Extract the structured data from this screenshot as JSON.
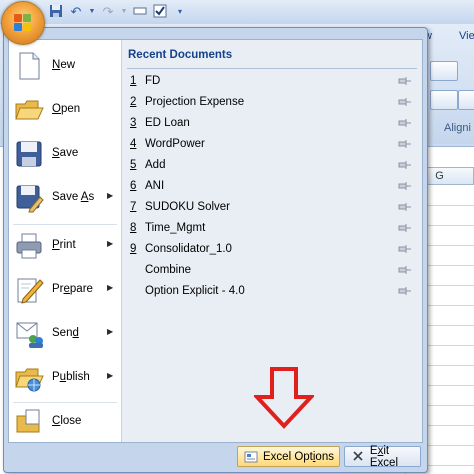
{
  "ribbon": {
    "tabs": [
      "View",
      "View"
    ],
    "group_label": "Aligni",
    "column_header": "G"
  },
  "quick_access": {
    "icons": [
      "save-icon",
      "undo-icon",
      "redo-icon",
      "customize-icon"
    ]
  },
  "office_menu": {
    "commands": [
      {
        "label_pre": "",
        "label_acc": "N",
        "label_post": "ew",
        "has_submenu": false
      },
      {
        "label_pre": "",
        "label_acc": "O",
        "label_post": "pen",
        "has_submenu": false
      },
      {
        "label_pre": "",
        "label_acc": "S",
        "label_post": "ave",
        "has_submenu": false
      },
      {
        "label_pre": "Save ",
        "label_acc": "A",
        "label_post": "s",
        "has_submenu": true
      },
      {
        "label_pre": "",
        "label_acc": "P",
        "label_post": "rint",
        "has_submenu": true
      },
      {
        "label_pre": "Pr",
        "label_acc": "e",
        "label_post": "pare",
        "has_submenu": true
      },
      {
        "label_pre": "Sen",
        "label_acc": "d",
        "label_post": "",
        "has_submenu": true
      },
      {
        "label_pre": "P",
        "label_acc": "u",
        "label_post": "blish",
        "has_submenu": true
      },
      {
        "label_pre": "",
        "label_acc": "C",
        "label_post": "lose",
        "has_submenu": false
      }
    ],
    "recent_title": "Recent Documents",
    "recent_docs": [
      {
        "num": "1",
        "name": "FD"
      },
      {
        "num": "2",
        "name": "Projection Expense"
      },
      {
        "num": "3",
        "name": "ED Loan"
      },
      {
        "num": "4",
        "name": "WordPower"
      },
      {
        "num": "5",
        "name": "Add"
      },
      {
        "num": "6",
        "name": "ANI"
      },
      {
        "num": "7",
        "name": "SUDOKU Solver"
      },
      {
        "num": "8",
        "name": "Time_Mgmt"
      },
      {
        "num": "9",
        "name": "Consolidator_1.0"
      },
      {
        "num": "",
        "name": "Combine"
      },
      {
        "num": "",
        "name": "Option Explicit - 4.0"
      }
    ],
    "options_button": {
      "pre": "Excel Opt",
      "acc": "i",
      "post": "ons"
    },
    "exit_button": {
      "pre": "E",
      "acc": "x",
      "post": "it Excel"
    }
  },
  "colors": {
    "accent": "#15428b",
    "annotation_arrow": "#e0201c",
    "options_highlight": "#ffd975"
  }
}
